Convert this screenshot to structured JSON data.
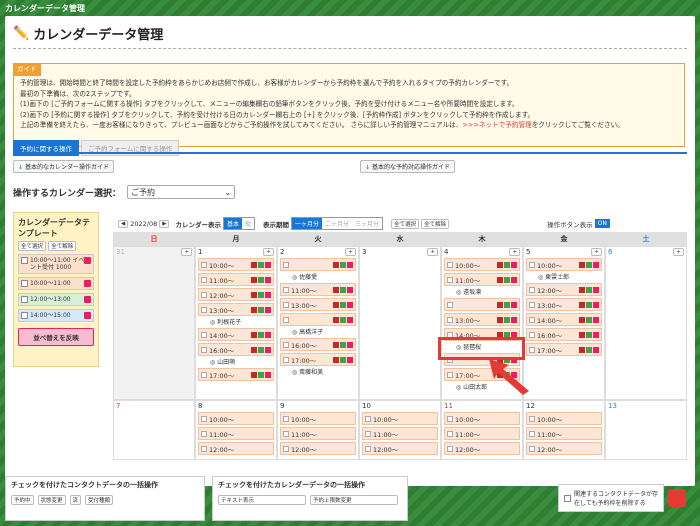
{
  "topbar": {
    "title": "カレンダーデータ管理"
  },
  "page": {
    "title": "カレンダーデータ管理"
  },
  "guide": {
    "tag": "ガイド",
    "lines": [
      "予約管理は、開始時間と終了時間を設定した予約枠をあらかじめお店側で作成し、お客様がカレンダーから予約枠を選んで予約を入れるタイプの予約カレンダーです。",
      "最初の下準備は、次の2ステップです。",
      "(1)画下の [ご予約フォームに関する操作] タブをクリックして、メニューの編集欄右の鉛筆ボタンをクリック後、予約を受け付けるメニュー名や所要時間を設定します。",
      "(2)画下の [予約に関する操作] タブをクリックして、予約を受け付ける日のカレンダー欄右上の [+] をクリック後、[予約枠作成] ボタンをクリックして予約枠を作成します。",
      "上記の準備を終えたら、一度お客様になりきって、プレビュー画面などからご予約操作を試してみてください。 さらに詳しい予約管理マニュアルは、"
    ],
    "link": ">>>ネットで予約管理",
    "tail": "をクリックしてご覧ください。"
  },
  "tabs": {
    "active": "予約に関する操作",
    "inactive": "ご予約フォームに関する操作"
  },
  "guides": {
    "left": "基本的なカレンダー操作ガイド",
    "right": "基本的な予約対応操作ガイド"
  },
  "select": {
    "label": "操作するカレンダー選択：",
    "value": "ご予約"
  },
  "template": {
    "title": "カレンダーデータテンプレート",
    "selectAll": "全て選択",
    "clearAll": "全て解除",
    "items": [
      "10:00〜11:00 イベント受付 1000",
      "10:00〜11:00",
      "12:00〜13:00",
      "14:00〜15:00"
    ],
    "reflect": "並べ替えを反映"
  },
  "calbar": {
    "month": "2022/08",
    "display": "カレンダー表示",
    "basic": "基本",
    "vertical": "縦",
    "period": "表示期間",
    "m1": "一ヶ月分",
    "m2": "二ヶ月分",
    "m3": "三ヶ月分",
    "selectAll": "全て選択",
    "clearAll": "全て解除",
    "opBtn": "操作ボタン表示",
    "on": "ON"
  },
  "weekdays": [
    "日",
    "月",
    "火",
    "水",
    "木",
    "金",
    "土"
  ],
  "week1": [
    {
      "d": "31",
      "gray": true,
      "slots": []
    },
    {
      "d": "1",
      "slots": [
        "10:00〜",
        "11:00〜",
        "12:00〜",
        "13:00〜",
        "14:00〜",
        "16:00〜",
        "17:00〜"
      ],
      "names": [
        null,
        null,
        null,
        "利根花子",
        null,
        "山田萌",
        null
      ]
    },
    {
      "d": "2",
      "slots": [
        "",
        "11:00〜",
        "13:00〜",
        "",
        "16:00〜",
        "17:00〜"
      ],
      "names": [
        "佐藤愛",
        null,
        null,
        "高橋洋子",
        null,
        "斎藤和美"
      ]
    },
    {
      "d": "3",
      "slots": []
    },
    {
      "d": "4",
      "slots": [
        "10:00〜",
        "11:00〜",
        "",
        "13:00〜",
        "14:00〜",
        "",
        "17:00〜"
      ],
      "names": [
        null,
        "遠坂凛",
        null,
        null,
        "琵琶桜",
        null,
        "山田太郎"
      ]
    },
    {
      "d": "5",
      "slots": [
        "10:00〜",
        "12:00〜",
        "13:00〜",
        "14:00〜",
        "16:00〜",
        "17:00〜"
      ],
      "names": [
        "東雲士郎",
        null,
        null,
        null,
        null,
        null
      ]
    },
    {
      "d": "6",
      "slots": []
    }
  ],
  "week2": [
    "7",
    "8",
    "9",
    "10",
    "11",
    "12",
    "13"
  ],
  "bottom": {
    "contact": "チェックを付けたコンタクトデータの一括操作",
    "calendar": "チェックを付けたカレンダーデータの一括操作",
    "sel1": "予約中",
    "status": "状態変更",
    "sel2": "済",
    "kind": "受付種類",
    "textDisplay": "テキスト表示",
    "resv": "予約上限数変更",
    "note": "関連するコンタクトデータが存在しても予約枠を削除する"
  }
}
